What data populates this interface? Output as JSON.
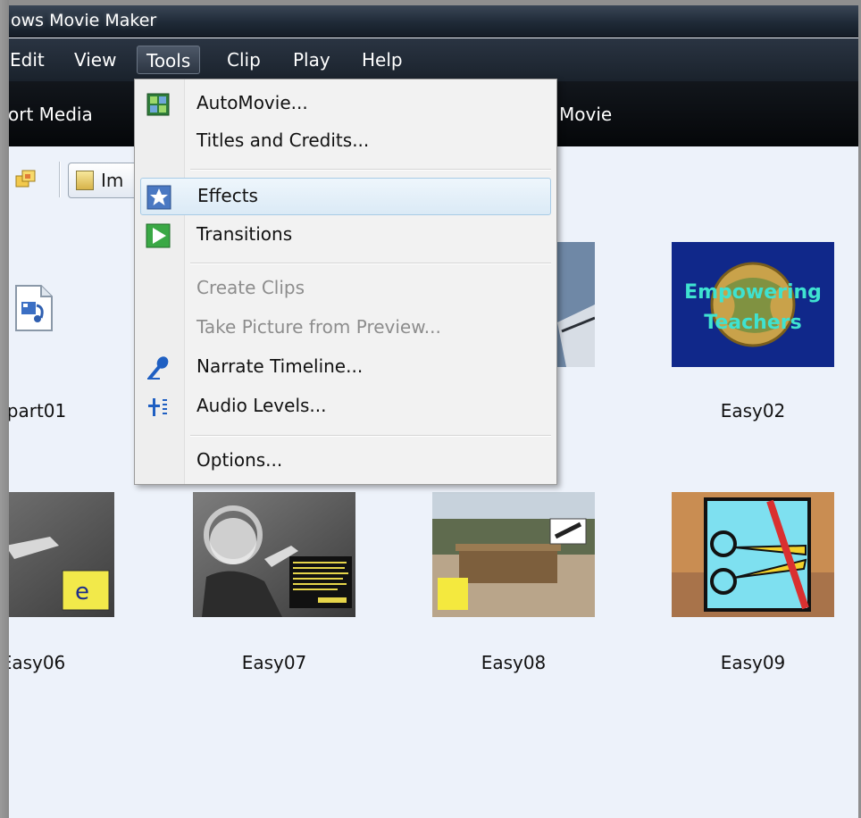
{
  "window": {
    "title": "ows Movie Maker"
  },
  "menubar": {
    "items": [
      {
        "label": "Edit"
      },
      {
        "label": "View"
      },
      {
        "label": "Tools"
      },
      {
        "label": "Clip"
      },
      {
        "label": "Play"
      },
      {
        "label": "Help"
      }
    ]
  },
  "taskbar": {
    "left_task": "ort Media",
    "right_task": "Movie"
  },
  "toolbar": {
    "import_button_label": "Im"
  },
  "tools_menu": {
    "items": [
      {
        "label": "AutoMovie...",
        "enabled": true,
        "icon": "automovie-icon"
      },
      {
        "label": "Titles and Credits...",
        "enabled": true
      },
      {
        "label": "Effects",
        "enabled": true,
        "icon": "effects-star-icon",
        "highlighted": true
      },
      {
        "label": "Transitions",
        "enabled": true,
        "icon": "transitions-icon"
      },
      {
        "label": "Create Clips",
        "enabled": false
      },
      {
        "label": "Take Picture from Preview...",
        "enabled": false
      },
      {
        "label": "Narrate Timeline...",
        "enabled": true,
        "icon": "microphone-icon"
      },
      {
        "label": "Audio Levels...",
        "enabled": true,
        "icon": "audio-levels-icon"
      },
      {
        "label": "Options...",
        "enabled": true
      }
    ]
  },
  "clips": {
    "row1": [
      {
        "name": "part01"
      },
      {
        "name": "Easy02",
        "thumb_text_1": "Empowering",
        "thumb_text_2": "Teachers"
      }
    ],
    "row2": [
      {
        "name": "Easy06"
      },
      {
        "name": "Easy07"
      },
      {
        "name": "Easy08"
      },
      {
        "name": "Easy09"
      }
    ]
  },
  "colors": {
    "window_bg": "#edf2fa",
    "menubar_bg": "#1a222c",
    "menu_highlight": "#dbeaf6",
    "disabled_text": "#8d8d8d"
  }
}
